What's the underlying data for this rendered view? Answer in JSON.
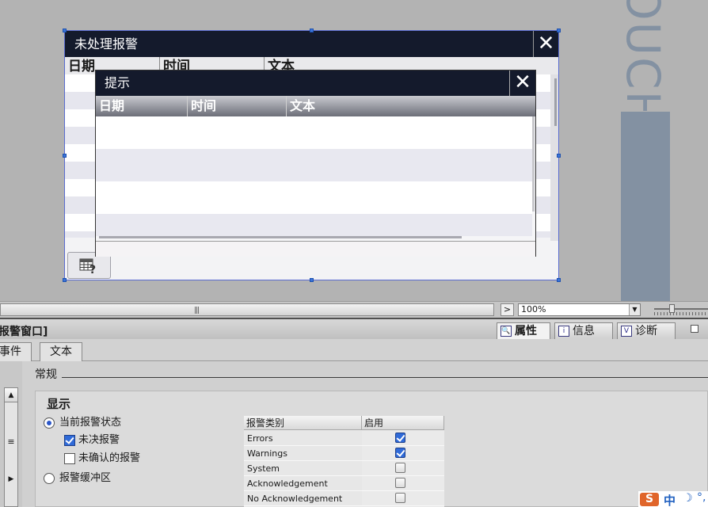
{
  "canvas": {
    "brand_text": "OUCH",
    "alarm_window": {
      "title": "未处理报警",
      "columns": [
        "日期",
        "时间",
        "文本"
      ]
    },
    "tip_window": {
      "title": "提示",
      "columns": [
        "日期",
        "时间",
        "文本"
      ]
    },
    "close_glyph": "✕",
    "footer_button_icon": "alarm-table-help-icon"
  },
  "zoombar": {
    "scroll_grip": "|||",
    "nav_arrow": ">",
    "zoom_value": "100%",
    "zoom_dropdown_glyph": "▼"
  },
  "panel": {
    "title": "报警窗口]",
    "tabs": [
      {
        "label": "属性",
        "icon": "properties-icon",
        "active": true
      },
      {
        "label": "信息",
        "icon": "info-icon",
        "active": false
      },
      {
        "label": "诊断",
        "icon": "diagnostics-icon",
        "active": false
      }
    ],
    "subtabs": [
      "事件",
      "文本"
    ],
    "section_label": "常规",
    "group_title": "显示",
    "radios": [
      {
        "label": "当前报警状态",
        "checked": true
      },
      {
        "label": "报警缓冲区",
        "checked": false
      }
    ],
    "checks": [
      {
        "label": "未决报警",
        "checked": true
      },
      {
        "label": "未确认的报警",
        "checked": false
      }
    ],
    "alarm_table": {
      "headers": [
        "报警类别",
        "启用"
      ],
      "rows": [
        {
          "name": "Errors",
          "enabled": true
        },
        {
          "name": "Warnings",
          "enabled": true
        },
        {
          "name": "System",
          "enabled": false
        },
        {
          "name": "Acknowledgement",
          "enabled": false
        },
        {
          "name": "No Acknowledgement",
          "enabled": false
        }
      ]
    }
  },
  "ime": {
    "logo": "S",
    "mode": "中",
    "moon": "☽",
    "punct": "°,"
  },
  "colors": {
    "title_bar": "#141a2c",
    "brand_gray": "#8391a2",
    "checkbox_blue": "#2f6ad8",
    "canvas_bg": "#b3b3b3"
  }
}
